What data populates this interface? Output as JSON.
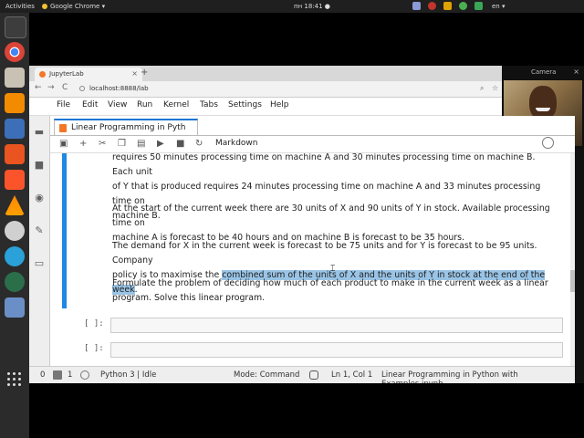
{
  "topbar": {
    "activities": "Activities",
    "app": "Google Chrome ▾",
    "clock": "пн 18:41 ●",
    "lang": "en ▾",
    "tray_colors": [
      "#8c9ad6",
      "#c2352c",
      "#e0a200",
      "#4caf50",
      "#3aa757"
    ]
  },
  "dock": {
    "apps": [
      "terminal",
      "chrome",
      "files",
      "sublime-text",
      "document-viewer",
      "software-center",
      "brave",
      "vlc",
      "gear",
      "screen",
      "firefox",
      "system-monitor"
    ]
  },
  "browser": {
    "tab_title": "JupyterLab",
    "tab_close": "×",
    "new_tab": "+",
    "back": "←",
    "forward": "→",
    "reload": "C",
    "url": "localhost:8888/lab",
    "zoom_icon": "⌕",
    "star_icon": "☆"
  },
  "camera": {
    "label": "Camera",
    "close": "×"
  },
  "menu": [
    "File",
    "Edit",
    "View",
    "Run",
    "Kernel",
    "Tabs",
    "Settings",
    "Help"
  ],
  "notebook": {
    "tab_title": "Linear Programming in Pyth",
    "tab_close": "×",
    "cell_type": "Markdown",
    "paragraphs": [
      {
        "line1": "requires 50 minutes processing time on machine A and 30 minutes processing time on machine B. Each unit",
        "line2": "of Y that is produced requires 24 minutes processing time on machine A and 33 minutes processing time on",
        "line3": "machine B."
      },
      {
        "line1": "At the start of the current week there are 30 units of X and 90 units of Y in stock. Available processing time on",
        "line2": "machine A is forecast to be 40 hours and on machine B is forecast to be 35 hours."
      },
      {
        "line1": "The demand for X in the current week is forecast to be 75 units and for Y is forecast to be 95 units. Company",
        "line2_plain": "policy is to maximise the ",
        "line2_highlight": "combined sum of the units of X and the units of Y in stock at the end of the week",
        "line2_end": "."
      },
      {
        "line1": "Formulate the problem of deciding how much of each product to make in the current week as a linear",
        "line2": "program. Solve this linear program."
      }
    ],
    "prompts": [
      "[ ]:",
      "[ ]:"
    ]
  },
  "status": {
    "count_a": "0",
    "count_b": "1",
    "kernel": "Python 3 | Idle",
    "mode": "Mode: Command",
    "position": "Ln 1, Col 1",
    "filename": "Linear Programming in Python with Examples.ipynb"
  },
  "colors": {
    "accent": "#1e88e5",
    "highlight": "#99c4e6",
    "jupyter_orange": "#f37726"
  }
}
